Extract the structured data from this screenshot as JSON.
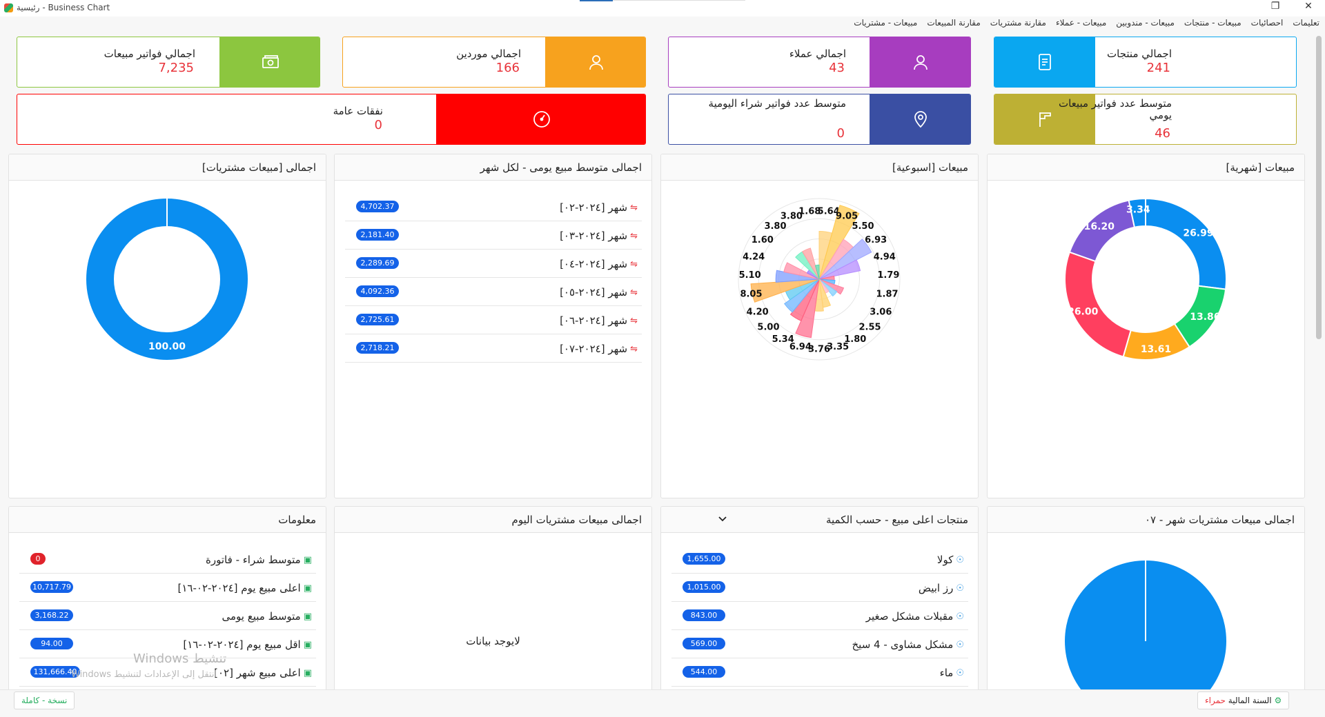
{
  "window": {
    "title": "رئيسية - Business Chart",
    "restore_glyph": "❐",
    "close_glyph": "✕"
  },
  "menu": [
    "مبيعات - مشتريات",
    "مقارنة المبيعات",
    "مقارنة مشتريات",
    "مبيعات - عملاء",
    "مبيعات - مندوبين",
    "مبيعات - منتجات",
    "احصائيات",
    "تعليمات"
  ],
  "kpis": {
    "products": {
      "label": "اجمالي منتجات",
      "value": "241",
      "color": "#0aa7f0",
      "icon": "document-icon"
    },
    "customers": {
      "label": "اجمالي عملاء",
      "value": "43",
      "color": "#a73dbf",
      "icon": "user-icon"
    },
    "suppliers": {
      "label": "اجمالي موردين",
      "value": "166",
      "color": "#f7a21e",
      "icon": "user-icon"
    },
    "sales_invoices": {
      "label": "اجمالي فواتير مبيعات",
      "value": "7,235",
      "color": "#8cc63f",
      "icon": "money-icon"
    },
    "avg_daily_sales_invoices": {
      "label": "متوسط عدد فواتير مبيعات يومي",
      "value": "46",
      "color": "#bdb034",
      "icon": "flag-icon"
    },
    "avg_daily_purchase_invoices": {
      "label": "متوسط عدد فواتير شراء اليومية",
      "value": "0",
      "color": "#3a4fa3",
      "icon": "location-icon"
    },
    "general_expenses": {
      "label": "نفقات عامة",
      "value": "0",
      "color": "#ff0000",
      "icon": "gauge-icon"
    }
  },
  "panels": {
    "monthly_sales": {
      "title": "مبيعات [شهرية]"
    },
    "weekly_sales": {
      "title": "مبيعات [اسبوعية]"
    },
    "avg_daily_per_month": {
      "title": "اجمالى متوسط مبيع يومى - لكل شهر"
    },
    "total_sales_purchases": {
      "title": "اجمالى [مبيعات مشتريات]"
    },
    "month_total": {
      "title": "اجمالى مبيعات مشتريات شهر - ٠٧"
    },
    "top_products": {
      "title": "منتجات اعلى مبيع - حسب الكمية"
    },
    "today_total": {
      "title": "اجمالى مبيعات مشتريات اليوم",
      "empty_text": "لايوجد بيانات"
    },
    "info": {
      "title": "معلومات"
    }
  },
  "avg_daily_rows": [
    {
      "label": "شهر [٢٠٢٤-٠٢]",
      "value": "4,702.37"
    },
    {
      "label": "شهر [٢٠٢٤-٠٣]",
      "value": "2,181.40"
    },
    {
      "label": "شهر [٢٠٢٤-٠٤]",
      "value": "2,289.69"
    },
    {
      "label": "شهر [٢٠٢٤-٠٥]",
      "value": "4,092.36"
    },
    {
      "label": "شهر [٢٠٢٤-٠٦]",
      "value": "2,725.61"
    },
    {
      "label": "شهر [٢٠٢٤-٠٧]",
      "value": "2,718.21"
    }
  ],
  "top_products_rows": [
    {
      "label": "كولا",
      "value": "1,655.00"
    },
    {
      "label": "رز ابيض",
      "value": "1,015.00"
    },
    {
      "label": "مقبلات مشكل صغير",
      "value": "843.00"
    },
    {
      "label": "مشكل مشاوى - 4 سيخ",
      "value": "569.00"
    },
    {
      "label": "ماء",
      "value": "544.00"
    }
  ],
  "info_rows": [
    {
      "label": "متوسط شراء - فاتورة",
      "value": "0",
      "red": true
    },
    {
      "label": "اعلى مبيع يوم [٢٠٢٤-٠٢-١٦]",
      "value": "10,717.79"
    },
    {
      "label": "متوسط مبيع يومى",
      "value": "3,168.22"
    },
    {
      "label": "اقل مبيع يوم [٢٠٢٤-٠٢-١٦]",
      "value": "94.00"
    },
    {
      "label": "اعلى مبيع شهر [٠٢]",
      "value": "131,666.40"
    }
  ],
  "footer": {
    "fiscal_year_label": "السنة المالية",
    "fiscal_year_value": "حمراء",
    "version": "نسخة - كاملة"
  },
  "watermark": {
    "line1": "تنشيط Windows",
    "line2": "انتقل إلى الإعدادات لتنشيط Windows"
  },
  "chart_data": [
    {
      "type": "pie",
      "variant": "donut",
      "title": "مبيعات [شهرية]",
      "values": [
        26.99,
        13.86,
        13.61,
        26.0,
        16.2,
        3.34
      ],
      "colors": [
        "#0a8ef0",
        "#19d26e",
        "#ffaa1e",
        "#ff3f5f",
        "#7d58d4",
        "#0a8ef0"
      ]
    },
    {
      "type": "polar-area",
      "title": "مبيعات [اسبوعية]",
      "values": [
        5.64,
        9.05,
        5.5,
        6.93,
        4.94,
        1.79,
        1.87,
        3.06,
        2.55,
        1.8,
        3.35,
        3.76,
        6.94,
        5.34,
        5.0,
        4.2,
        8.05,
        5.1,
        4.24,
        1.6,
        3.8,
        3.8,
        1.68
      ],
      "colors": [
        "#ffd27a",
        "#ffc94d",
        "#ff9fb5",
        "#9fa8ff",
        "#b58cff",
        "#ff6f8f",
        "#4fb0ff",
        "#ff7a9a",
        "#7fd0ff",
        "#ffb3c6",
        "#ffd06a",
        "#ffcf70",
        "#ff6f8f",
        "#ff5c7c",
        "#6fb5ff",
        "#5cc8f0",
        "#ffb04a",
        "#7c9cff",
        "#ff8fa8",
        "#9d7bff",
        "#6ff0c2",
        "#ff9fa0",
        "#5dd6a8"
      ],
      "axis_max": 9.5
    },
    {
      "type": "pie",
      "variant": "donut",
      "title": "اجمالى [مبيعات مشتريات]",
      "values": [
        100.0
      ],
      "colors": [
        "#0a8ef0"
      ]
    },
    {
      "type": "pie",
      "title": "اجمالى مبيعات مشتريات شهر - ٠٧",
      "values": [
        100.0
      ],
      "colors": [
        "#0a8ef0"
      ]
    }
  ]
}
